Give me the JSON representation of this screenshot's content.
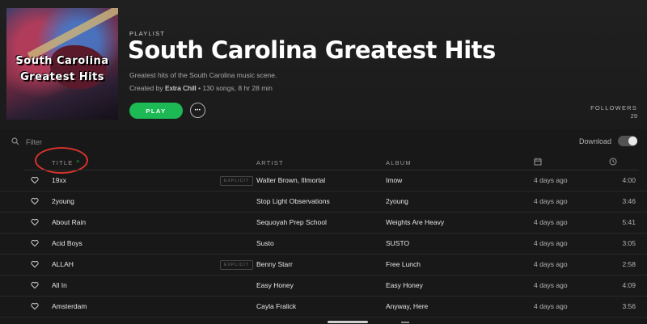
{
  "playlist": {
    "type_label": "PLAYLIST",
    "title": "South Carolina Greatest Hits",
    "description": "Greatest hits of the South Carolina music scene.",
    "created_by_prefix": "Created by",
    "owner": "Extra Chill",
    "stats": "• 130 songs, 8 hr 28 min",
    "cover_line1": "South Carolina",
    "cover_line2": "Greatest Hits"
  },
  "actions": {
    "play_label": "PLAY",
    "more_label": "•••"
  },
  "followers": {
    "label": "FOLLOWERS",
    "count": "29"
  },
  "filter": {
    "placeholder": "Filter"
  },
  "download": {
    "label": "Download",
    "enabled": false
  },
  "columns": {
    "title": "TITLE",
    "artist": "ARTIST",
    "album": "ALBUM"
  },
  "tracks": [
    {
      "title": "19xx",
      "explicit": "EXPLICIT",
      "artist": "Walter Brown, Illmortal",
      "album": "Imow",
      "added": "4 days ago",
      "duration": "4:00"
    },
    {
      "title": "2young",
      "explicit": "",
      "artist": "Stop Light Observations",
      "album": "2young",
      "added": "4 days ago",
      "duration": "3:46"
    },
    {
      "title": "About Rain",
      "explicit": "",
      "artist": "Sequoyah Prep School",
      "album": "Weights Are Heavy",
      "added": "4 days ago",
      "duration": "5:41"
    },
    {
      "title": "Acid Boys",
      "explicit": "",
      "artist": "Susto",
      "album": "SUSTO",
      "added": "4 days ago",
      "duration": "3:05"
    },
    {
      "title": "ALLAH",
      "explicit": "EXPLICIT",
      "artist": "Benny Starr",
      "album": "Free Lunch",
      "added": "4 days ago",
      "duration": "2:58"
    },
    {
      "title": "All In",
      "explicit": "",
      "artist": "Easy Honey",
      "album": "Easy Honey",
      "added": "4 days ago",
      "duration": "4:09"
    },
    {
      "title": "Amsterdam",
      "explicit": "",
      "artist": "Cayla Fralick",
      "album": "Anyway, Here",
      "added": "4 days ago",
      "duration": "3:56"
    }
  ],
  "colors": {
    "accent": "#1db954",
    "annotation": "#d6322b",
    "background": "#181818"
  },
  "icons": {
    "search": "search-icon",
    "heart": "heart-icon",
    "calendar": "calendar-icon",
    "clock": "clock-icon",
    "sort": "chevron-up-icon"
  }
}
